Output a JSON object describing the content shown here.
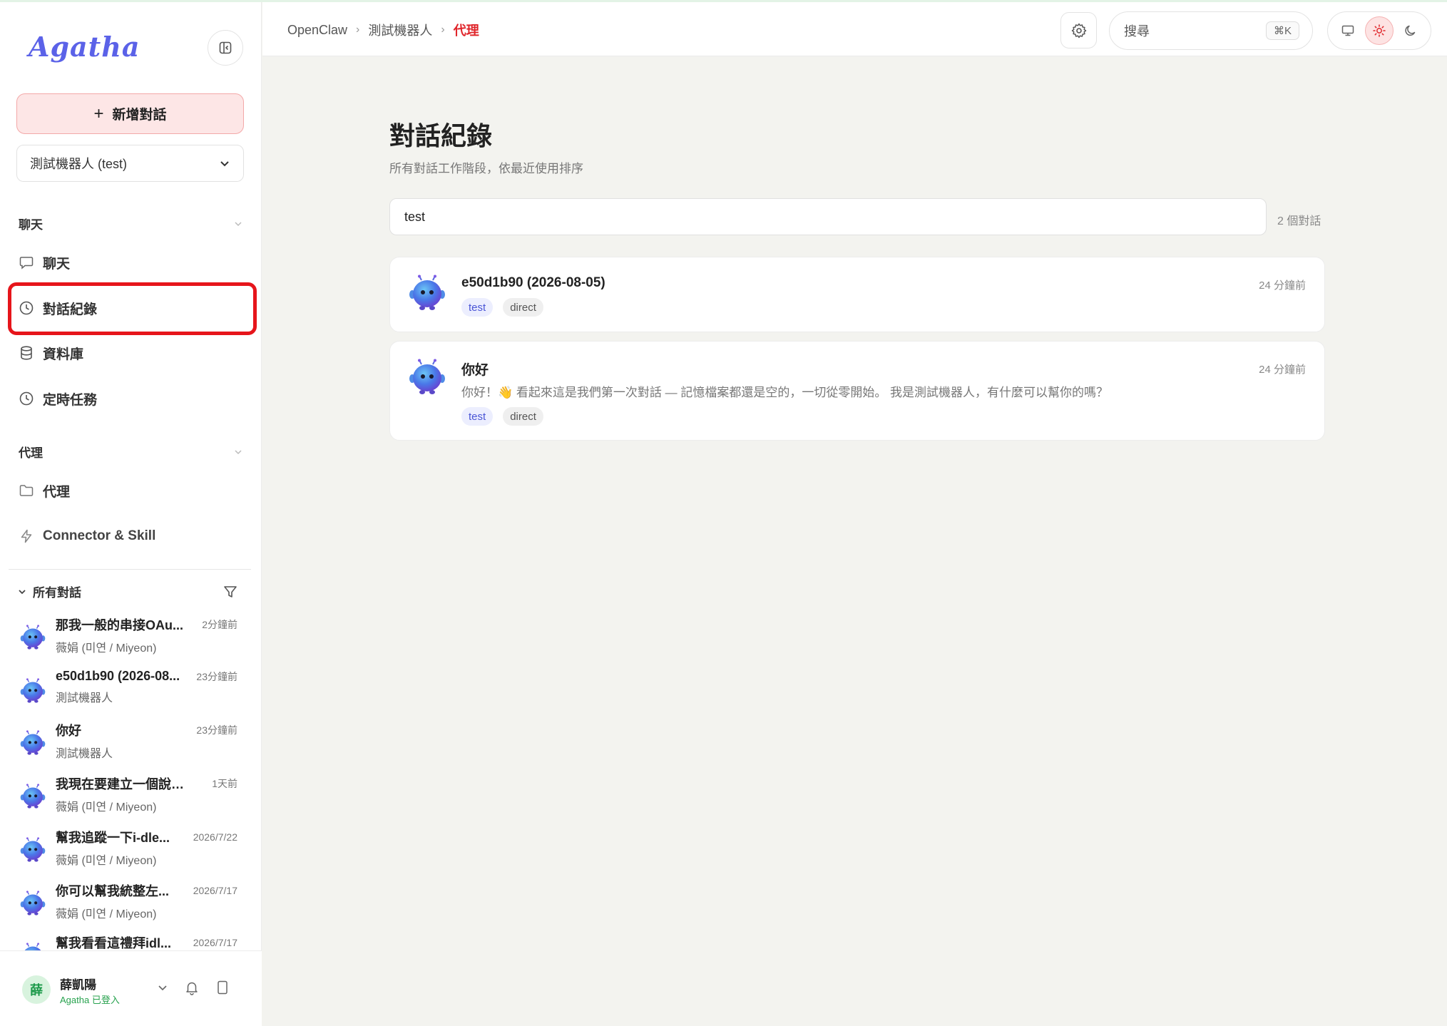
{
  "app": {
    "logo_text": "Agatha",
    "new_chat_label": "新增對話",
    "agent_selector": "測試機器人 (test)"
  },
  "sidebar": {
    "chat_section": "聊天",
    "nav_chat": [
      {
        "label": "聊天",
        "icon": "message-icon"
      },
      {
        "label": "對話紀錄",
        "icon": "clock-icon"
      },
      {
        "label": "資料庫",
        "icon": "database-icon"
      },
      {
        "label": "定時任務",
        "icon": "clock-icon"
      }
    ],
    "agent_section": "代理",
    "nav_agent": [
      {
        "label": "代理",
        "icon": "folder-icon"
      },
      {
        "label": "Connector & Skill",
        "icon": "bolt-icon"
      }
    ],
    "all_conversations": "所有對話",
    "conversations": [
      {
        "title": "那我一般的串接OAu...",
        "time": "2分鐘前",
        "owner": "薇娟 (미연 / Miyeon)"
      },
      {
        "title": "e50d1b90 (2026-08...",
        "time": "23分鐘前",
        "owner": "測試機器人"
      },
      {
        "title": "你好",
        "time": "23分鐘前",
        "owner": "測試機器人"
      },
      {
        "title": "我現在要建立一個說明...",
        "time": "1天前",
        "owner": "薇娟 (미연 / Miyeon)"
      },
      {
        "title": "幫我追蹤一下i-dle...",
        "time": "2026/7/22",
        "owner": "薇娟 (미연 / Miyeon)"
      },
      {
        "title": "你可以幫我統整左...",
        "time": "2026/7/17",
        "owner": "薇娟 (미연 / Miyeon)"
      },
      {
        "title": "幫我看看這禮拜idl...",
        "time": "2026/7/17",
        "owner": ""
      }
    ],
    "user": {
      "avatar_char": "薛",
      "name": "薛凱陽",
      "status": "Agatha 已登入"
    }
  },
  "header": {
    "breadcrumb": [
      "OpenClaw",
      "測試機器人",
      "代理"
    ],
    "search_placeholder": "搜尋",
    "shortcut": "⌘K"
  },
  "main": {
    "title": "對話紀錄",
    "subtitle": "所有對話工作階段，依最近使用排序",
    "search_value": "test",
    "count": "2 個對話",
    "sessions": [
      {
        "title": "e50d1b90 (2026-08-05)",
        "time": "24 分鐘前",
        "preview": "",
        "tags": [
          "test",
          "direct"
        ]
      },
      {
        "title": "你好",
        "time": "24 分鐘前",
        "preview": "你好！👋 看起來這是我們第一次對話 — 記憶檔案都還是空的，一切從零開始。 我是測試機器人，有什麼可以幫你的嗎？",
        "tags": [
          "test",
          "direct"
        ]
      }
    ]
  },
  "colors": {
    "accent_red": "#e0262b",
    "highlight": "#e6151b",
    "tag_test": "#4a55d6"
  }
}
